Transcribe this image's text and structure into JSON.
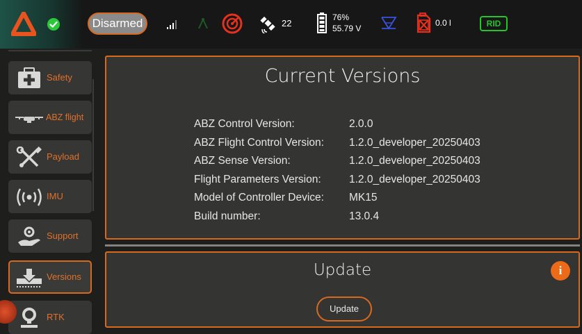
{
  "topbar": {
    "arm_status": "Disarmed",
    "satellite_count": "22",
    "battery_percent": "76%",
    "battery_voltage": "55.79 V",
    "fuel": "0.0 l",
    "rid_label": "RID"
  },
  "sidebar": {
    "items": [
      {
        "label": "Safety",
        "icon": "first-aid-icon"
      },
      {
        "label": "ABZ flight",
        "icon": "drone-icon"
      },
      {
        "label": "Payload",
        "icon": "tools-icon"
      },
      {
        "label": "IMU",
        "icon": "radio-waves-icon"
      },
      {
        "label": "Support",
        "icon": "support-hand-gear-icon"
      },
      {
        "label": "Versions",
        "icon": "download-tray-icon"
      },
      {
        "label": "RTK",
        "icon": "location-pin-icon"
      }
    ],
    "active": "Versions"
  },
  "versions": {
    "title": "Current Versions",
    "rows": [
      {
        "key": "ABZ Control Version:",
        "value": "2.0.0"
      },
      {
        "key": "ABZ Flight Control Version:",
        "value": "1.2.0_developer_20250403"
      },
      {
        "key": "ABZ Sense Version:",
        "value": "1.2.0_developer_20250403"
      },
      {
        "key": "Flight Parameters Version:",
        "value": "1.2.0_developer_20250403"
      },
      {
        "key": "Model of Controller Device:",
        "value": "MK15"
      },
      {
        "key": "Build number:",
        "value": "13.0.4"
      }
    ]
  },
  "update": {
    "title": "Update",
    "button_label": "Update",
    "info_glyph": "i"
  },
  "colors": {
    "accent": "#d9691f",
    "panel": "#343532",
    "ok_green": "#25c62a"
  }
}
